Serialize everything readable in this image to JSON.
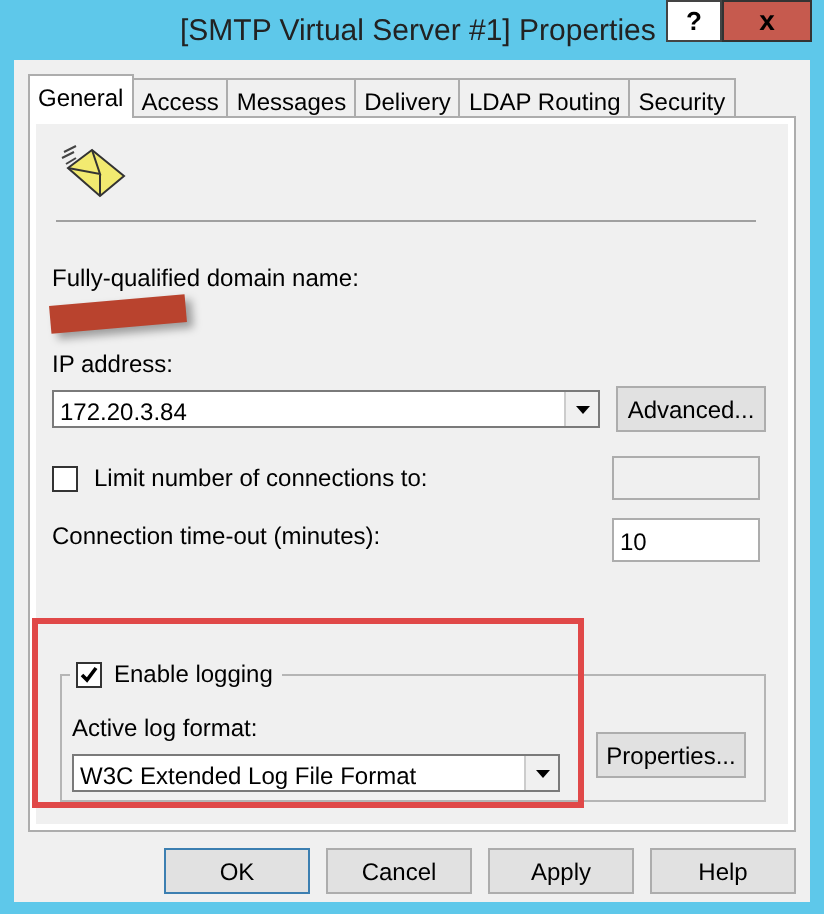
{
  "window": {
    "title": "[SMTP Virtual Server #1] Properties",
    "help_button": "?",
    "close_button": "x"
  },
  "tabs": [
    {
      "label": "General",
      "selected": true
    },
    {
      "label": "Access",
      "selected": false
    },
    {
      "label": "Messages",
      "selected": false
    },
    {
      "label": "Delivery",
      "selected": false
    },
    {
      "label": "LDAP Routing",
      "selected": false
    },
    {
      "label": "Security",
      "selected": false
    }
  ],
  "general": {
    "domain_label": "Fully-qualified domain name:",
    "ip_label": "IP address:",
    "ip_value": "172.20.3.84",
    "advanced_button": "Advanced...",
    "limit_connections": {
      "label": "Limit number of connections to:",
      "checked": false,
      "field_disabled": true
    },
    "timeout_label": "Connection time-out (minutes):",
    "timeout_value": "10",
    "logging": {
      "label": "Enable logging",
      "checked": true,
      "format_label": "Active log format:",
      "format_value": "W3C Extended Log File Format",
      "properties_button": "Properties..."
    }
  },
  "buttons": [
    {
      "label": "OK",
      "default": true
    },
    {
      "label": "Cancel",
      "default": false
    },
    {
      "label": "Apply",
      "default": false
    },
    {
      "label": "Help",
      "default": false
    }
  ]
}
